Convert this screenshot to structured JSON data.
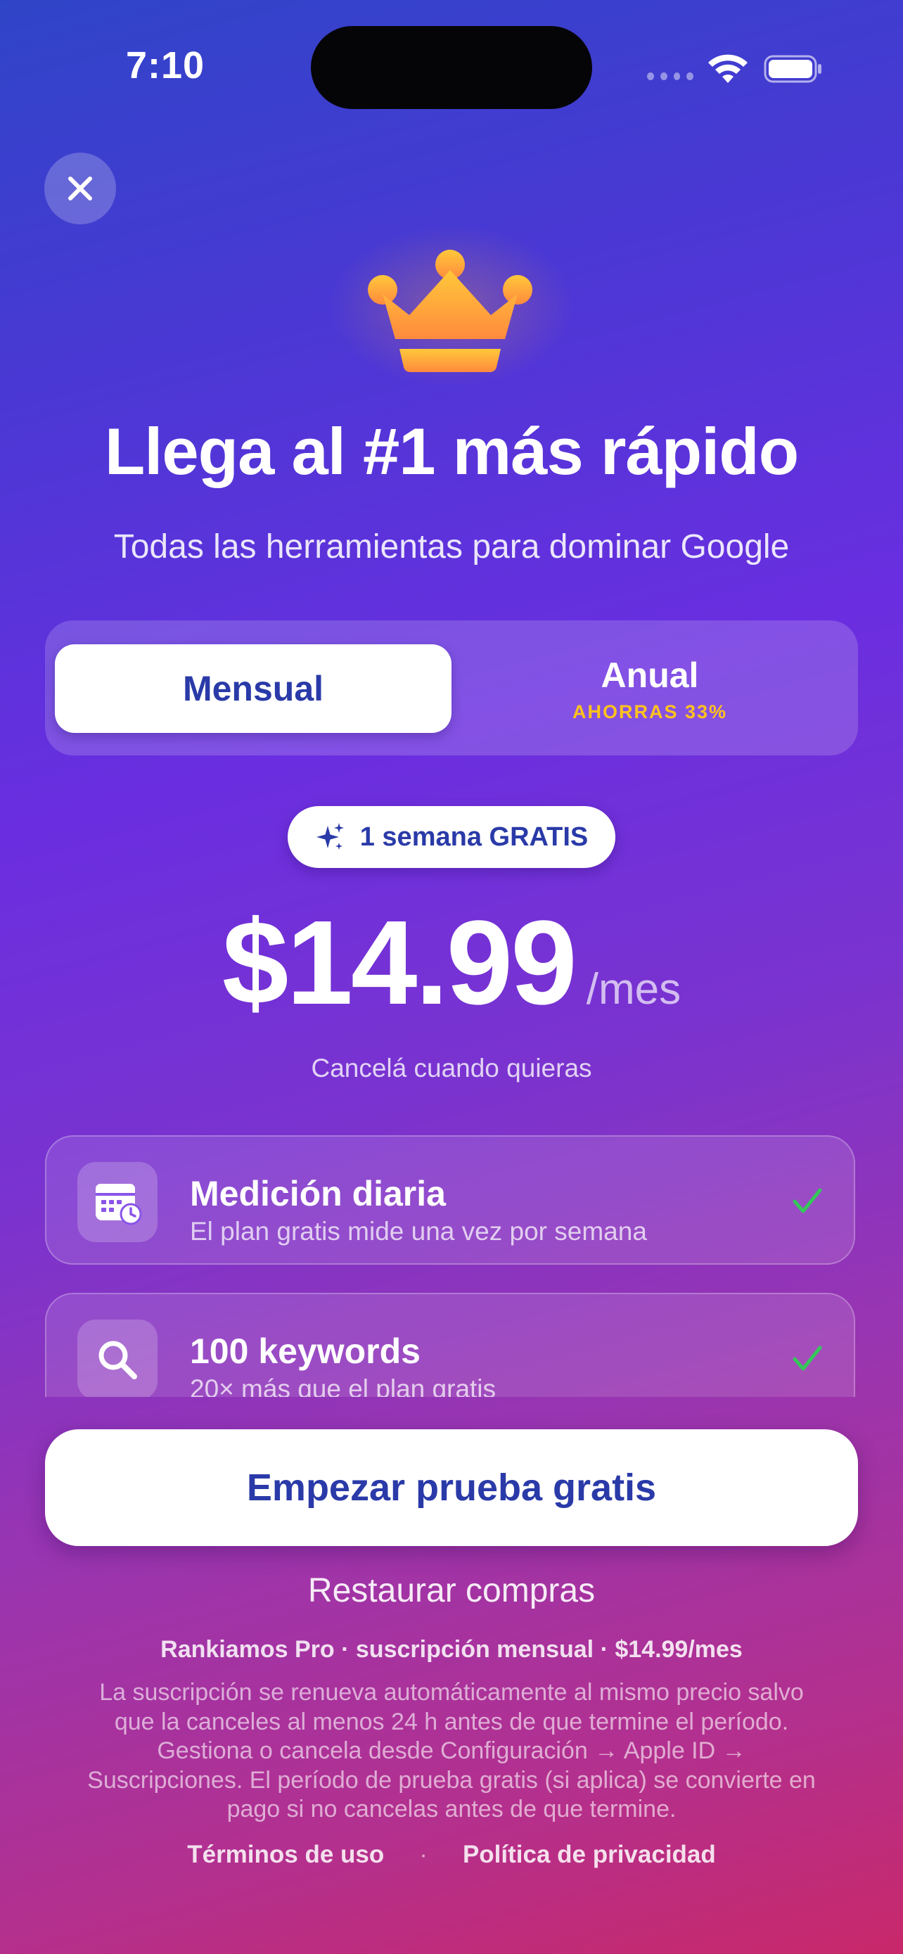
{
  "status_bar": {
    "time": "7:10"
  },
  "header": {
    "title": "Llega al #1 más rápido",
    "subtitle": "Todas las herramientas para dominar Google"
  },
  "plan_toggle": {
    "monthly_label": "Mensual",
    "annual_label": "Anual",
    "annual_savings": "AHORRAS 33%",
    "selected": "Mensual"
  },
  "trial_badge": {
    "label": "1 semana GRATIS"
  },
  "pricing": {
    "price": "$14.99",
    "period": "/mes",
    "note": "Cancelá cuando quieras"
  },
  "features": [
    {
      "title": "Medición diaria",
      "description": "El plan gratis mide una vez por semana",
      "icon": "calendar-clock-icon"
    },
    {
      "title": "100 keywords",
      "description": "20× más que el plan gratis",
      "icon": "search-icon"
    }
  ],
  "cta": {
    "label": "Empezar prueba gratis"
  },
  "restore": {
    "label": "Restaurar compras"
  },
  "footer": {
    "plan_summary": "Rankiamos Pro · suscripción mensual · $14.99/mes",
    "legal": "La suscripción se renueva automáticamente al mismo precio salvo que la canceles al menos 24 h antes de que termine el período. Gestiona o cancela desde Configuración → Apple ID → Suscripciones. El período de prueba gratis (si aplica) se convierte en pago si no cancelas antes de que termine.",
    "terms": "Términos de uso",
    "separator": "·",
    "privacy": "Política de privacidad"
  },
  "colors": {
    "accent_text": "#2a3aa8",
    "savings": "#ffc21e",
    "check": "#34c759",
    "crown_top": "#ffc83a",
    "crown_bottom": "#ff8a3d"
  }
}
